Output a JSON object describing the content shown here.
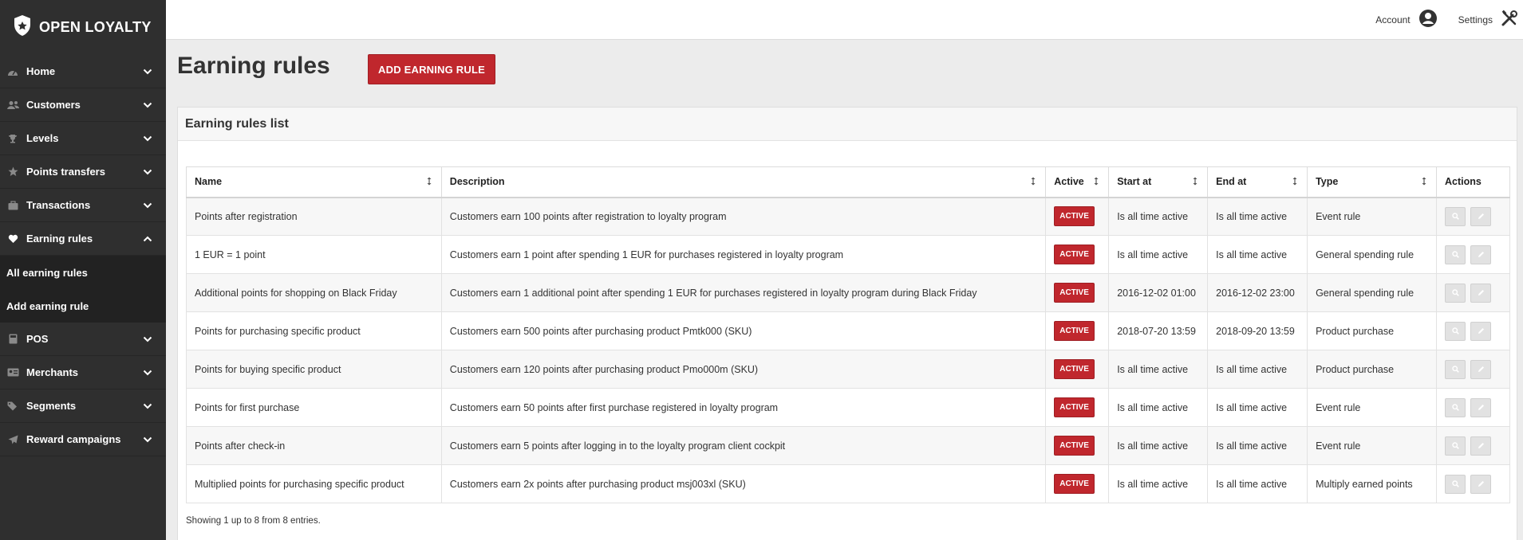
{
  "brand": {
    "name": "OPEN LOYALTY"
  },
  "sidebar": {
    "items": [
      {
        "label": "Home",
        "icon": "dashboard-icon",
        "expanded": false
      },
      {
        "label": "Customers",
        "icon": "users-icon",
        "expanded": false
      },
      {
        "label": "Levels",
        "icon": "trophy-icon",
        "expanded": false
      },
      {
        "label": "Points transfers",
        "icon": "star-icon",
        "expanded": false
      },
      {
        "label": "Transactions",
        "icon": "briefcase-icon",
        "expanded": false
      },
      {
        "label": "Earning rules",
        "icon": "heart-icon",
        "expanded": true
      },
      {
        "label": "POS",
        "icon": "pos-icon",
        "expanded": false
      },
      {
        "label": "Merchants",
        "icon": "id-card-icon",
        "expanded": false
      },
      {
        "label": "Segments",
        "icon": "tags-icon",
        "expanded": false
      },
      {
        "label": "Reward campaigns",
        "icon": "send-icon",
        "expanded": false
      }
    ],
    "earning_submenu": [
      "All earning rules",
      "Add earning rule"
    ]
  },
  "topbar": {
    "account_label": "Account",
    "settings_label": "Settings"
  },
  "page": {
    "title": "Earning rules",
    "add_button": "ADD EARNING RULE"
  },
  "panel": {
    "title": "Earning rules list"
  },
  "table": {
    "columns": [
      "Name",
      "Description",
      "Active",
      "Start at",
      "End at",
      "Type",
      "Actions"
    ],
    "rows": [
      {
        "name": "Points after registration",
        "description": "Customers earn 100 points after registration to loyalty program",
        "active": "ACTIVE",
        "start": "Is all time active",
        "end": "Is all time active",
        "type": "Event rule"
      },
      {
        "name": "1 EUR = 1 point",
        "description": "Customers earn 1 point after spending 1 EUR for purchases registered in loyalty program",
        "active": "ACTIVE",
        "start": "Is all time active",
        "end": "Is all time active",
        "type": "General spending rule"
      },
      {
        "name": "Additional points for shopping on Black Friday",
        "description": "Customers earn 1 additional point after spending 1 EUR for purchases registered in loyalty program during Black Friday",
        "active": "ACTIVE",
        "start": "2016-12-02 01:00",
        "end": "2016-12-02 23:00",
        "type": "General spending rule"
      },
      {
        "name": "Points for purchasing specific product",
        "description": "Customers earn 500 points after purchasing product Pmtk000 (SKU)",
        "active": "ACTIVE",
        "start": "2018-07-20 13:59",
        "end": "2018-09-20 13:59",
        "type": "Product purchase"
      },
      {
        "name": "Points for buying specific product",
        "description": "Customers earn 120 points after purchasing product Pmo000m (SKU)",
        "active": "ACTIVE",
        "start": "Is all time active",
        "end": "Is all time active",
        "type": "Product purchase"
      },
      {
        "name": "Points for first purchase",
        "description": "Customers earn 50 points after first purchase registered in loyalty program",
        "active": "ACTIVE",
        "start": "Is all time active",
        "end": "Is all time active",
        "type": "Event rule"
      },
      {
        "name": "Points after check-in",
        "description": "Customers earn 5 points after logging in to the loyalty program client cockpit",
        "active": "ACTIVE",
        "start": "Is all time active",
        "end": "Is all time active",
        "type": "Event rule"
      },
      {
        "name": "Multiplied points for purchasing specific product",
        "description": "Customers earn 2x points after purchasing product msj003xl (SKU)",
        "active": "ACTIVE",
        "start": "Is all time active",
        "end": "Is all time active",
        "type": "Multiply earned points"
      }
    ]
  },
  "footer": {
    "text": "Showing 1 up to 8 from 8 entries."
  },
  "colors": {
    "accent": "#c0272d",
    "sidebar_bg": "#2f2f2f",
    "submenu_bg": "#222222"
  }
}
